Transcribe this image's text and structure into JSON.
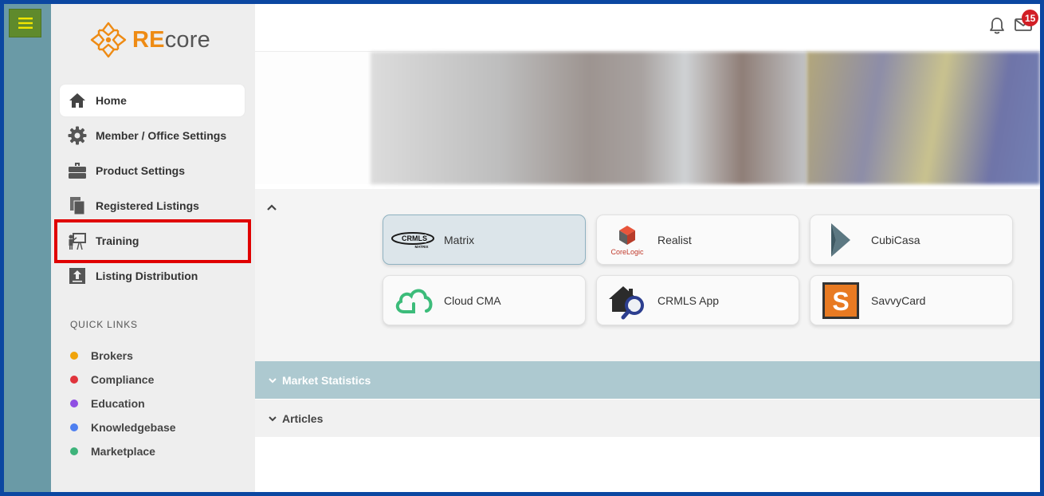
{
  "brand": {
    "re": "RE",
    "core": "core",
    "accent": "#ee8b14"
  },
  "nav": {
    "items": [
      {
        "label": "Home",
        "icon": "home-icon",
        "active": true
      },
      {
        "label": "Member / Office Settings",
        "icon": "gear-icon"
      },
      {
        "label": "Product Settings",
        "icon": "toolbox-icon"
      },
      {
        "label": "Registered Listings",
        "icon": "documents-icon"
      },
      {
        "label": "Training",
        "icon": "presentation-icon"
      },
      {
        "label": "Listing Distribution",
        "icon": "upload-icon"
      }
    ]
  },
  "quick_links": {
    "title": "QUICK LINKS",
    "items": [
      {
        "label": "Brokers",
        "color": "#f0a30a"
      },
      {
        "label": "Compliance",
        "color": "#e0343c"
      },
      {
        "label": "Education",
        "color": "#8f4fe3"
      },
      {
        "label": "Knowledgebase",
        "color": "#4e7ff0"
      },
      {
        "label": "Marketplace",
        "color": "#3db37a"
      }
    ]
  },
  "header": {
    "notification_count": "15"
  },
  "apps": [
    {
      "label": "Matrix",
      "logo": "crmls-matrix-logo"
    },
    {
      "label": "Realist",
      "logo": "corelogic-logo"
    },
    {
      "label": "CubiCasa",
      "logo": "cubicasa-logo"
    },
    {
      "label": "Cloud CMA",
      "logo": "cloud-cma-logo"
    },
    {
      "label": "CRMLS App",
      "logo": "crmls-app-logo"
    },
    {
      "label": "SavvyCard",
      "logo": "savvycard-logo"
    }
  ],
  "logo_text": {
    "crmls": "CRMLS",
    "matrix": "MATRIX",
    "corelogic": "CoreLogic",
    "savvy": "S"
  },
  "sections": {
    "market": "Market Statistics",
    "articles": "Articles"
  }
}
